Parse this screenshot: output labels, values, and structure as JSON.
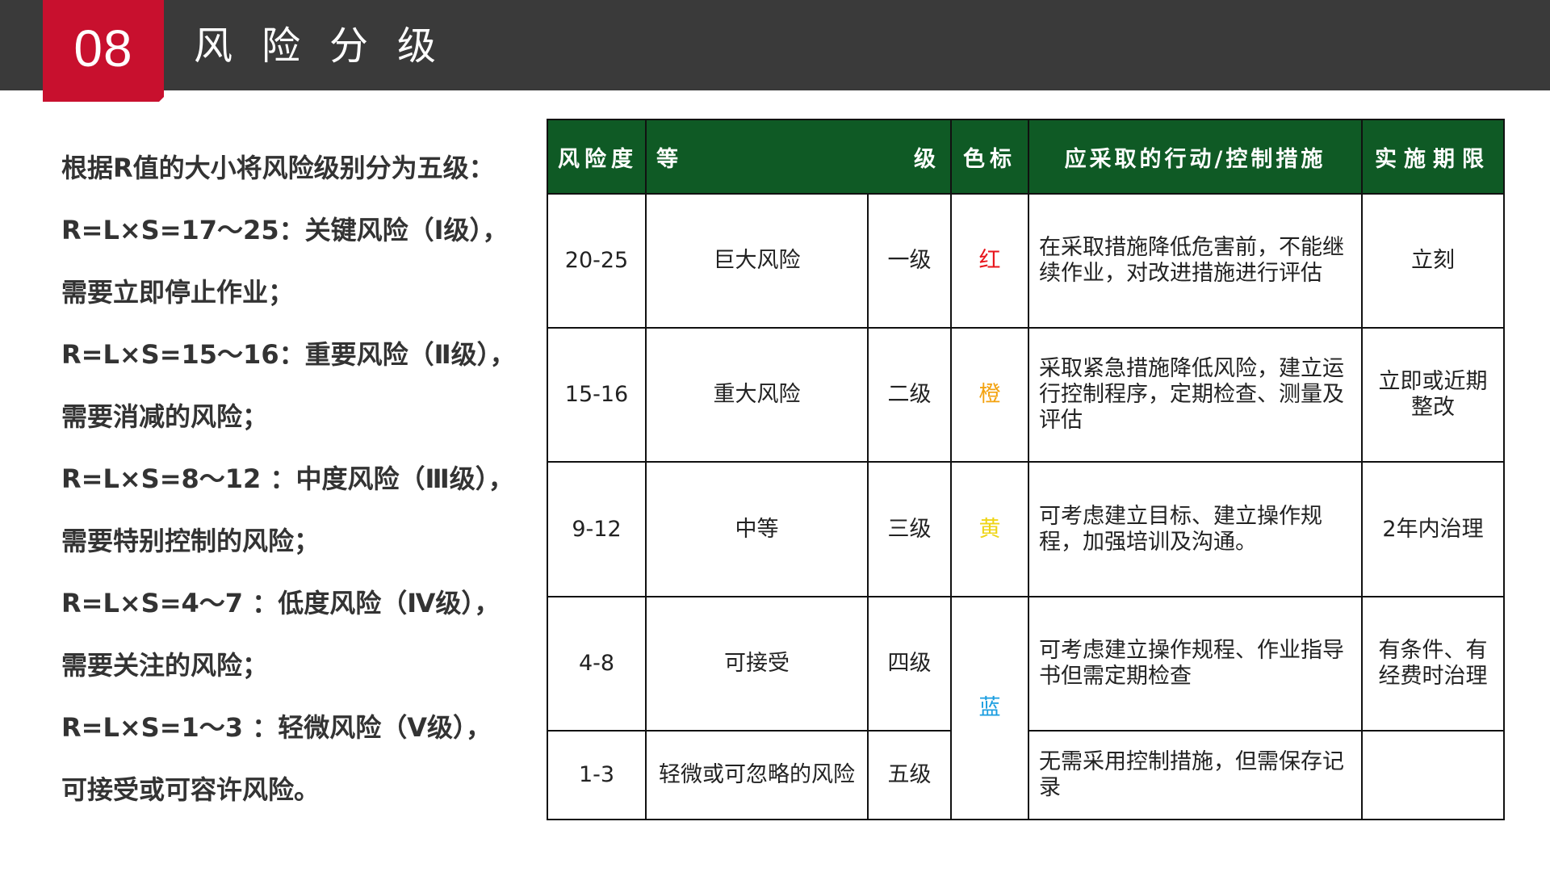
{
  "header": {
    "number": "08",
    "title": "风险分级"
  },
  "left_text": {
    "lines": [
      "根据R值的大小将风险级别分为五级：",
      "R=L×S=17～25：关键风险（Ⅰ级），",
      "需要立即停止作业；",
      "R=L×S=15～16：重要风险（Ⅱ级），",
      "需要消减的风险；",
      "R=L×S=8～12 ：中度风险（Ⅲ级），",
      "需要特别控制的风险；",
      "R=L×S=4～7  ：低度风险（Ⅳ级），",
      "需要关注的风险；",
      "R=L×S=1～3  ：轻微风险（Ⅴ级），",
      "可接受或可容许风险。"
    ]
  },
  "table": {
    "headers": {
      "degree": "风险度",
      "level_left": "等",
      "level_right": "级",
      "color": "色标",
      "action": "应采取的行动/控制措施",
      "period": "实施期限"
    },
    "rows": [
      {
        "degree": "20-25",
        "name": "巨大风险",
        "level": "一级",
        "color_label": "红",
        "action": "在采取措施降低危害前，不能继续作业，对改进措施进行评估",
        "period": "立刻"
      },
      {
        "degree": "15-16",
        "name": "重大风险",
        "level": "二级",
        "color_label": "橙",
        "action": "采取紧急措施降低风险，建立运行控制程序，定期检查、测量及评估",
        "period": "立即或近期整改"
      },
      {
        "degree": "9-12",
        "name": "中等",
        "level": "三级",
        "color_label": "黄",
        "action": "可考虑建立目标、建立操作规程，加强培训及沟通。",
        "period": "2年内治理"
      },
      {
        "degree": "4-8",
        "name": "可接受",
        "level": "四级",
        "color_label": "蓝",
        "action": "可考虑建立操作规程、作业指导书但需定期检查",
        "period": "有条件、有经费时治理"
      },
      {
        "degree": "1-3",
        "name": "轻微或可忽略的风险",
        "level": "五级",
        "action": "无需采用控制措施，但需保存记录",
        "period": ""
      }
    ],
    "colors": {
      "header_bg": "#0f5a25",
      "red": "#e8161d",
      "orange": "#f3a20f",
      "yellow": "#efd516",
      "blue": "#1b9ee0"
    }
  }
}
